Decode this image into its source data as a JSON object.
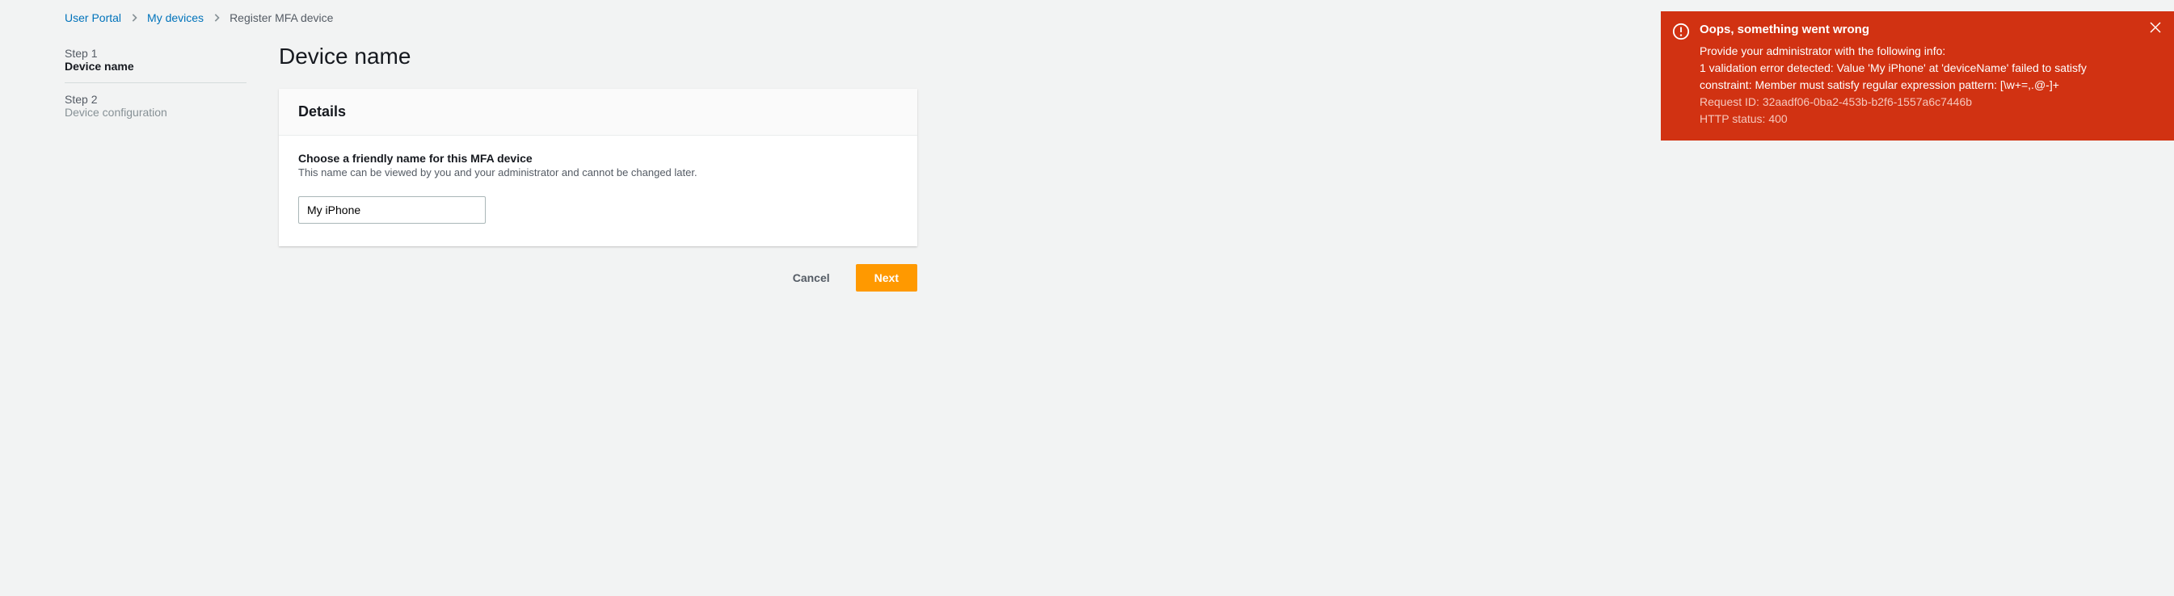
{
  "breadcrumb": {
    "link1": "User Portal",
    "link2": "My devices",
    "current": "Register MFA device"
  },
  "steps": {
    "s1_num": "Step 1",
    "s1_label": "Device name",
    "s2_num": "Step 2",
    "s2_label": "Device configuration"
  },
  "page_title": "Device name",
  "panel": {
    "header": "Details",
    "field_label": "Choose a friendly name for this MFA device",
    "field_help": "This name can be viewed by you and your administrator and cannot be changed later.",
    "input_value": "My iPhone"
  },
  "actions": {
    "cancel": "Cancel",
    "next": "Next"
  },
  "toast": {
    "title": "Oops, something went wrong",
    "line1": "Provide your administrator with the following info:",
    "line2": "1 validation error detected: Value 'My iPhone' at 'deviceName' failed to satisfy constraint: Member must satisfy regular expression pattern: [\\w+=,.@-]+",
    "request_id": "Request ID: 32aadf06-0ba2-453b-b2f6-1557a6c7446b",
    "status": "HTTP status: 400"
  }
}
